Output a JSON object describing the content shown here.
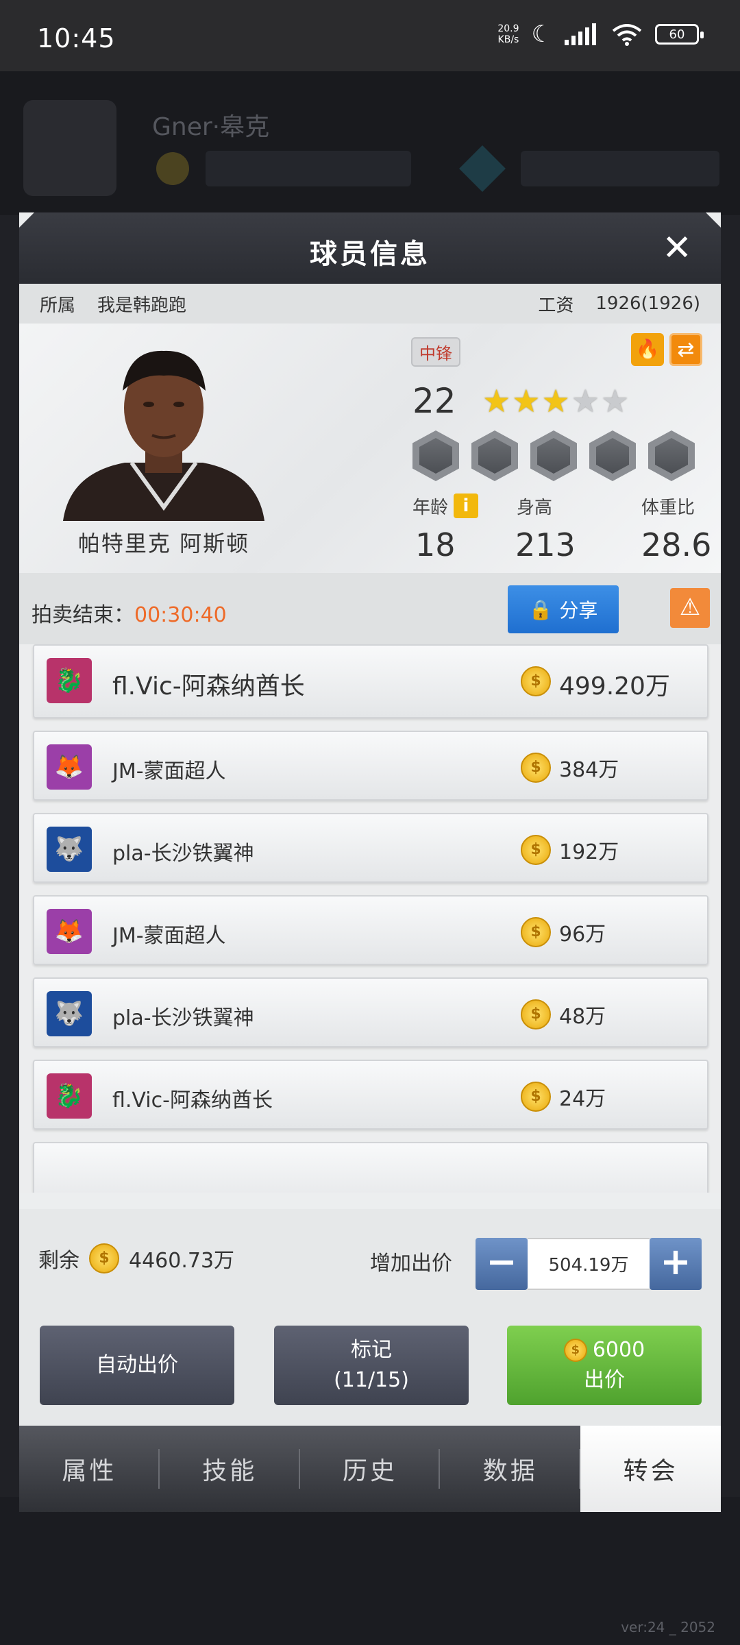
{
  "status_bar": {
    "time": "10:45",
    "net_speed": "20.9",
    "net_unit": "KB/s",
    "battery": "60"
  },
  "background": {
    "user_name": "Gner·皋克",
    "version": "ver:24 _ 2052"
  },
  "modal": {
    "title": "球员信息",
    "owner_label": "所属",
    "owner_value": "我是韩跑跑",
    "salary_label": "工资",
    "salary_value": "1926(1926)",
    "player": {
      "name": "帕特里克 阿斯顿",
      "position": "中锋",
      "level": "22",
      "stars_filled": 3,
      "stars_total": 5,
      "age_label": "年龄",
      "height_label": "身高",
      "weight_label": "体重比",
      "age": "18",
      "height": "213",
      "weight_ratio": "28.6"
    },
    "auction": {
      "label": "拍卖结束：",
      "time_left": "00:30:40",
      "share_label": "分享"
    },
    "bids": [
      {
        "team": "fl.Vic-阿森纳酋长",
        "amount": "499.20万",
        "logo": "dragon-logo",
        "color": "#b8336a"
      },
      {
        "team": "JM-蒙面超人",
        "amount": "384万",
        "logo": "fox-shield-logo",
        "color": "#9b3fa8"
      },
      {
        "team": "pla-长沙铁翼神",
        "amount": "192万",
        "logo": "wolf-logo",
        "color": "#1d4d9c"
      },
      {
        "team": "JM-蒙面超人",
        "amount": "96万",
        "logo": "fox-shield-logo",
        "color": "#9b3fa8"
      },
      {
        "team": "pla-长沙铁翼神",
        "amount": "48万",
        "logo": "wolf-logo",
        "color": "#1d4d9c"
      },
      {
        "team": "fl.Vic-阿森纳酋长",
        "amount": "24万",
        "logo": "dragon-logo",
        "color": "#b8336a"
      }
    ],
    "remaining_label": "剩余",
    "remaining_value": "4460.73万",
    "increase_label": "增加出价",
    "increase_value": "504.19万",
    "buttons": {
      "auto_bid": "自动出价",
      "mark_line1": "标记",
      "mark_line2": "(11/15)",
      "bid_amount": "6000",
      "bid_label": "出价"
    },
    "tabs": [
      "属性",
      "技能",
      "历史",
      "数据",
      "转会"
    ],
    "active_tab": "转会"
  }
}
